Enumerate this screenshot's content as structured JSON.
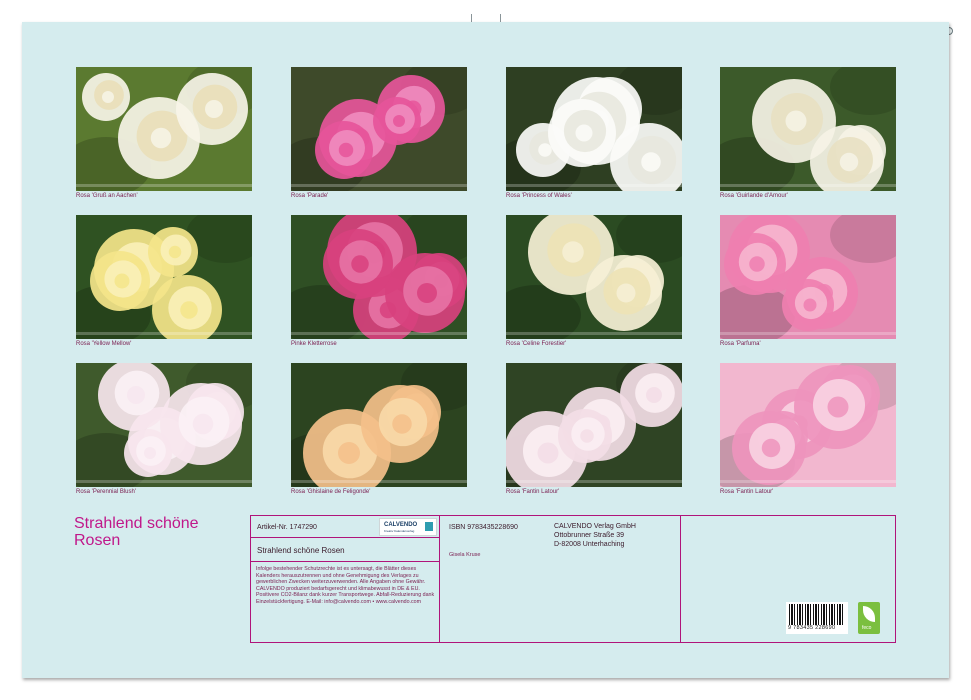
{
  "photos": [
    {
      "caption": "Rosa 'Gruß an Aachen'",
      "colors": [
        "#5b7a30",
        "#f7f4e8",
        "#eadfb8"
      ]
    },
    {
      "caption": "Rosa 'Parade'",
      "colors": [
        "#3e4a2a",
        "#e6559a",
        "#f08cbf"
      ]
    },
    {
      "caption": "Rosa 'Princess of Wales'",
      "colors": [
        "#2e3f22",
        "#fbfbf8",
        "#e8e8de"
      ]
    },
    {
      "caption": "Rosa 'Guirlande d'Amour'",
      "colors": [
        "#3c5a2a",
        "#f6f3e6",
        "#e8e0c2"
      ]
    },
    {
      "caption": "Rosa 'Yellow Mellow'",
      "colors": [
        "#2f5222",
        "#f4e58a",
        "#f9f0b8"
      ]
    },
    {
      "caption": "Pinke Kletterrose",
      "colors": [
        "#2f4f24",
        "#d8417e",
        "#e773a5"
      ]
    },
    {
      "caption": "Rosa 'Celine Forestier'",
      "colors": [
        "#2b4b22",
        "#f6f0d6",
        "#ede2b5"
      ]
    },
    {
      "caption": "Rosa 'Parfuma'",
      "colors": [
        "#e58bb2",
        "#ef7fb0",
        "#f6b6cf"
      ]
    },
    {
      "caption": "Rosa 'Perennial Blush'",
      "colors": [
        "#3f5a2c",
        "#f7e6ee",
        "#fbf1f5"
      ]
    },
    {
      "caption": "Rosa 'Ghislaine de Feligonde'",
      "colors": [
        "#2c4420",
        "#f4c08a",
        "#f8d9a8"
      ]
    },
    {
      "caption": "Rosa 'Fantin Latour'",
      "colors": [
        "#2f4424",
        "#f3dde6",
        "#fbeef3"
      ]
    },
    {
      "caption": "Rosa 'Fantin Latour'",
      "colors": [
        "#f2b7cf",
        "#ee94bd",
        "#f8d3e2"
      ]
    }
  ],
  "title_line1": "Strahlend schöne",
  "title_line2": "Rosen",
  "info": {
    "article": "Artikel-Nr. 1747290",
    "logo_text": "CALVENDO",
    "logo_sub": "Kreativ Kalenderverlag",
    "subtitle": "Strahlend schöne Rosen",
    "legal": "Infolge bestehender Schutzrechte ist es untersagt, die Blätter dieses Kalenders herauszutrennen und ohne Genehmigung des Verlages zu gewerblichen Zwecken weiterzuverwenden. Alle Angaben ohne Gewähr. CALVENDO produziert bedarfsgerecht und klimabewusst in DE & EU. Positivere CO2-Bilanz dank kurzer Transportwege. Abfall-Reduzierung dank Einzelstückfertigung. E-Mail: info@calvendo.com • www.calvendo.com",
    "isbn": "ISBN 9783435228690",
    "author": "Gisela Kruse",
    "publisher_line1": "CALVENDO Verlag GmbH",
    "publisher_line2": "Ottobrunner Straße 39",
    "publisher_line3": "D-82008 Unterhaching",
    "barcode_number": "9 783435 228690",
    "eco_label": "feco"
  },
  "accent_color": "#b0147a"
}
